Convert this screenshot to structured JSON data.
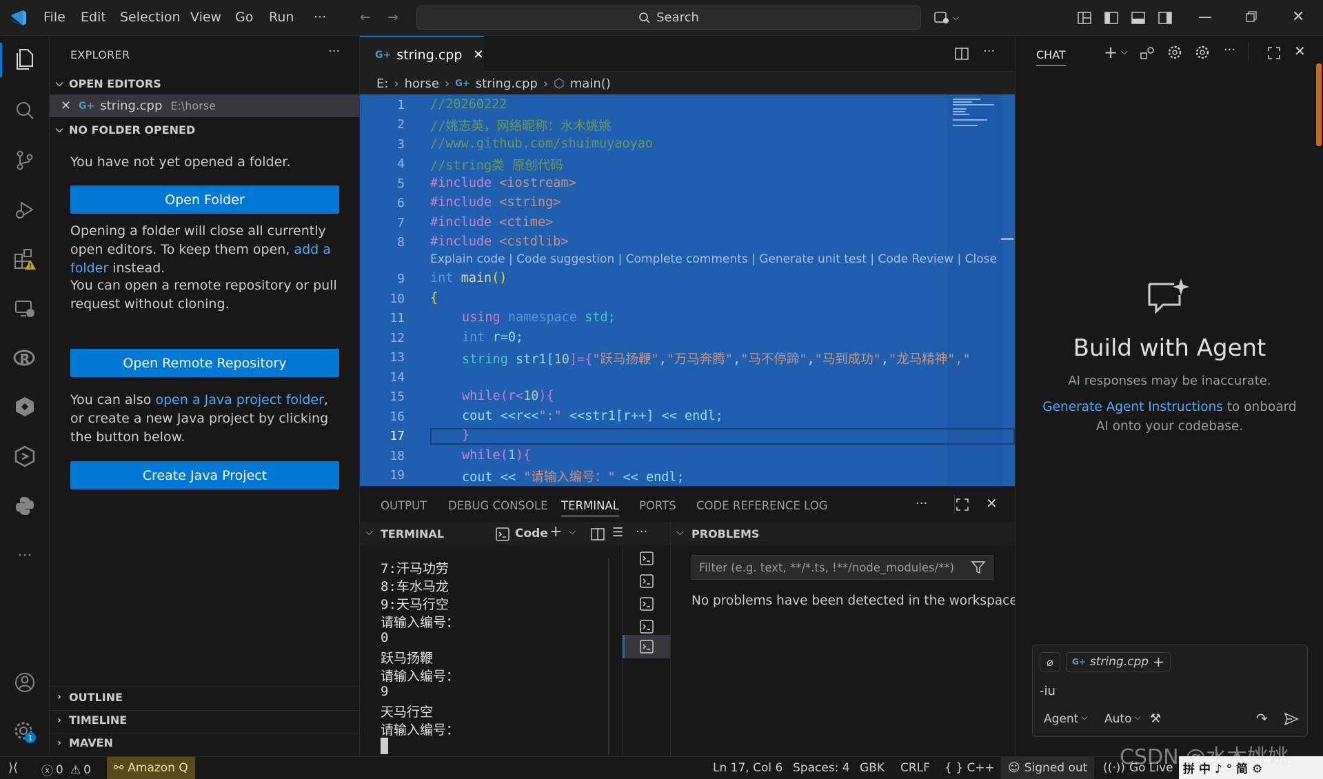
{
  "menu": [
    "File",
    "Edit",
    "Selection",
    "View",
    "Go",
    "Run",
    "···"
  ],
  "search": {
    "label": "Search"
  },
  "explorer": {
    "title": "EXPLORER",
    "open_editors": "OPEN EDITORS",
    "open_file": "string.cpp",
    "open_file_path": "E:\\horse",
    "no_folder": "NO FOLDER OPENED",
    "no_folder_text": "You have not yet opened a folder.",
    "open_folder_btn": "Open Folder",
    "para1_a": "Opening a folder will close all currently open editors. To keep them open, ",
    "para1_link": "add a folder",
    "para1_b": " instead.",
    "para2": "You can open a remote repository or pull request without cloning.",
    "open_remote_btn": "Open Remote Repository",
    "para3_a": "You can also ",
    "para3_link": "open a Java project folder",
    "para3_b": ", or create a new Java project by clicking the button below.",
    "create_java_btn": "Create Java Project",
    "outline": "OUTLINE",
    "timeline": "TIMELINE",
    "maven": "MAVEN"
  },
  "editor": {
    "tab": "string.cpp",
    "breadcrumb": [
      "E:",
      "horse",
      "string.cpp",
      "main()"
    ],
    "codelens": "Explain code | Code suggestion | Complete comments | Generate unit test | Code Review | Close",
    "line_numbers": [
      "1",
      "2",
      "3",
      "4",
      "5",
      "6",
      "7",
      "8",
      "9",
      "10",
      "11",
      "12",
      "13",
      "14",
      "15",
      "16",
      "17",
      "18",
      "19"
    ],
    "code": {
      "l1": "//20260222",
      "l2": "//姚志英，网络昵称：水木姚姚",
      "l3": "//www.github.com/shuimuyaoyao",
      "l4": "//string类 原创代码",
      "l5a": "#include ",
      "l5b": "<iostream>",
      "l6a": "#include ",
      "l6b": "<string>",
      "l7a": "#include ",
      "l7b": "<ctime>",
      "l8a": "#include ",
      "l8b": "<cstdlib>",
      "l9a": "int ",
      "l9b": "main",
      "l9c": "()",
      "l10": "{",
      "l11a": "using ",
      "l11b": "namespace ",
      "l11c": "std;",
      "l12a": "int ",
      "l12b": "r=0;",
      "l13a": "string ",
      "l13b": "str1[",
      "l13c": "10",
      "l13d": "]={",
      "l13e": "\"跃马扬鞭\"",
      "l13f": ",",
      "l13g": "\"万马奔腾\"",
      "l13h": ",",
      "l13i": "\"马不停蹄\"",
      "l13j": ",",
      "l13k": "\"马到成功\"",
      "l13l": ",",
      "l13m": "\"龙马精神\"",
      "l13n": ",\"",
      "l15a": "while",
      "l15b": "(r<",
      "l15c": "10",
      "l15d": "){",
      "l16a": "cout <<r<<",
      "l16b": "\":\"",
      "l16c": " <<str1[r++] << endl;",
      "l17": "}",
      "l18a": "while",
      "l18b": "(",
      "l18c": "1",
      "l18d": "){",
      "l19a": "cout << ",
      "l19b": "\"请输入编号：\"",
      "l19c": " << endl;"
    }
  },
  "panel": {
    "tabs": [
      "OUTPUT",
      "DEBUG CONSOLE",
      "TERMINAL",
      "PORTS",
      "CODE REFERENCE LOG"
    ],
    "terminal_title": "TERMINAL",
    "terminal_profile": "Code",
    "problems_title": "PROBLEMS",
    "filter_placeholder": "Filter (e.g. text, **/*.ts, !**/node_modules/**)",
    "no_problems": "No problems have been detected in the workspace.",
    "terminal_lines": [
      "7:汗马功劳",
      "8:车水马龙",
      "9:天马行空",
      "请输入编号：",
      "0",
      "跃马扬鞭",
      "请输入编号：",
      "9",
      "天马行空",
      "请输入编号："
    ]
  },
  "chat": {
    "title": "CHAT",
    "heading": "Build with Agent",
    "disclaimer": "AI responses may be inaccurate.",
    "link": "Generate Agent Instructions",
    "link_rest": " to onboard AI onto your codebase.",
    "context_file": "string.cpp",
    "input_value": "-iu",
    "mode": "Agent",
    "model": "Auto"
  },
  "status": {
    "errors": "0",
    "warnings": "0",
    "amazon": "Amazon Q",
    "position": "Ln 17, Col 6",
    "spaces": "Spaces: 4",
    "encoding": "GBK",
    "eol": "CRLF",
    "language": "{ }  C++",
    "signed_out": "Signed out",
    "go_live": "Go Live"
  },
  "colors": {
    "accent": "#0078d4",
    "selection": "#1f5fb0",
    "link": "#4daafc",
    "warning": "#cca700",
    "amazon": "#5a4a1a"
  },
  "overlay": {
    "ime": "拼 中 ♪ ° 简 ⚙",
    "watermark": "CSDN @水木姚姚"
  }
}
